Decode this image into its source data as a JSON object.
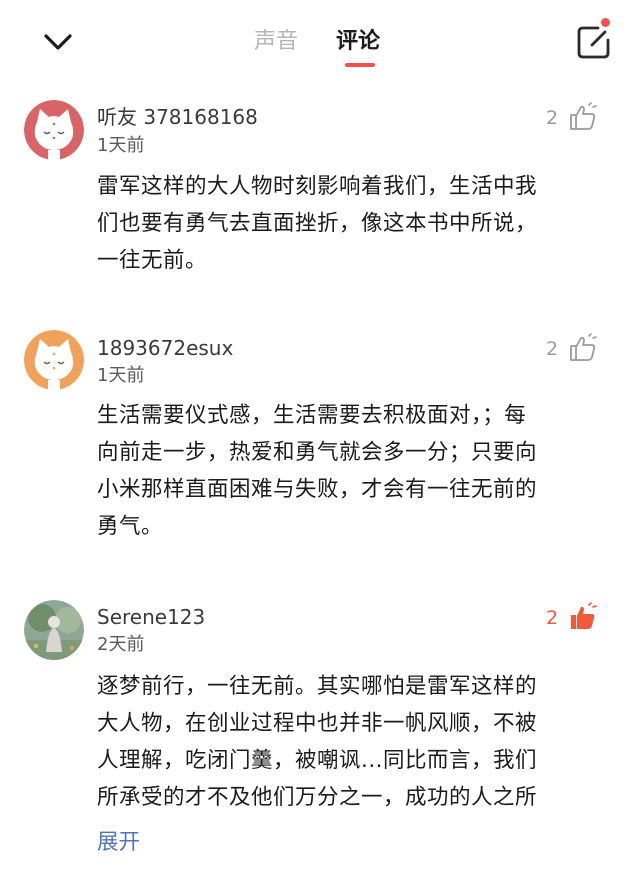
{
  "header": {
    "tabs": [
      {
        "label": "声音"
      },
      {
        "label": "评论"
      }
    ]
  },
  "comments": [
    {
      "username": "听友 378168168",
      "time": "1天前",
      "likes": "2",
      "liked": false,
      "avatar": "white-cat-avatar",
      "avatar_bg": "#d96467",
      "lines": [
        "雷军这样的大人物时刻影响着我们，生活中我",
        "们也要有勇气去直面挫折，像这本书中所说，",
        "一往无前。"
      ]
    },
    {
      "username": "1893672esux",
      "time": "1天前",
      "likes": "2",
      "liked": false,
      "avatar": "white-cat-avatar",
      "avatar_bg": "#f0a15a",
      "lines": [
        "生活需要仪式感，生活需要去积极面对，；每",
        "向前走一步，热爱和勇气就会多一分；只要向",
        "小米那样直面困难与失败，才会有一往无前的",
        "勇气。"
      ]
    },
    {
      "username": "Serene123",
      "time": "2天前",
      "likes": "2",
      "liked": true,
      "avatar": "photo-avatar",
      "avatar_bg": "#8fa896",
      "lines": [
        "逐梦前行，一往无前。其实哪怕是雷军这样的",
        "大人物，在创业过程中也并非一帆风顺，不被",
        "人理解，吃闭门羹，被嘲讽...同比而言，我们",
        "所承受的才不及他们万分之一，成功的人之所"
      ],
      "expand_label": "展开"
    }
  ],
  "colors": {
    "accent": "#f2504a",
    "liked": "#ef5a3c",
    "link": "#4d75b8"
  }
}
